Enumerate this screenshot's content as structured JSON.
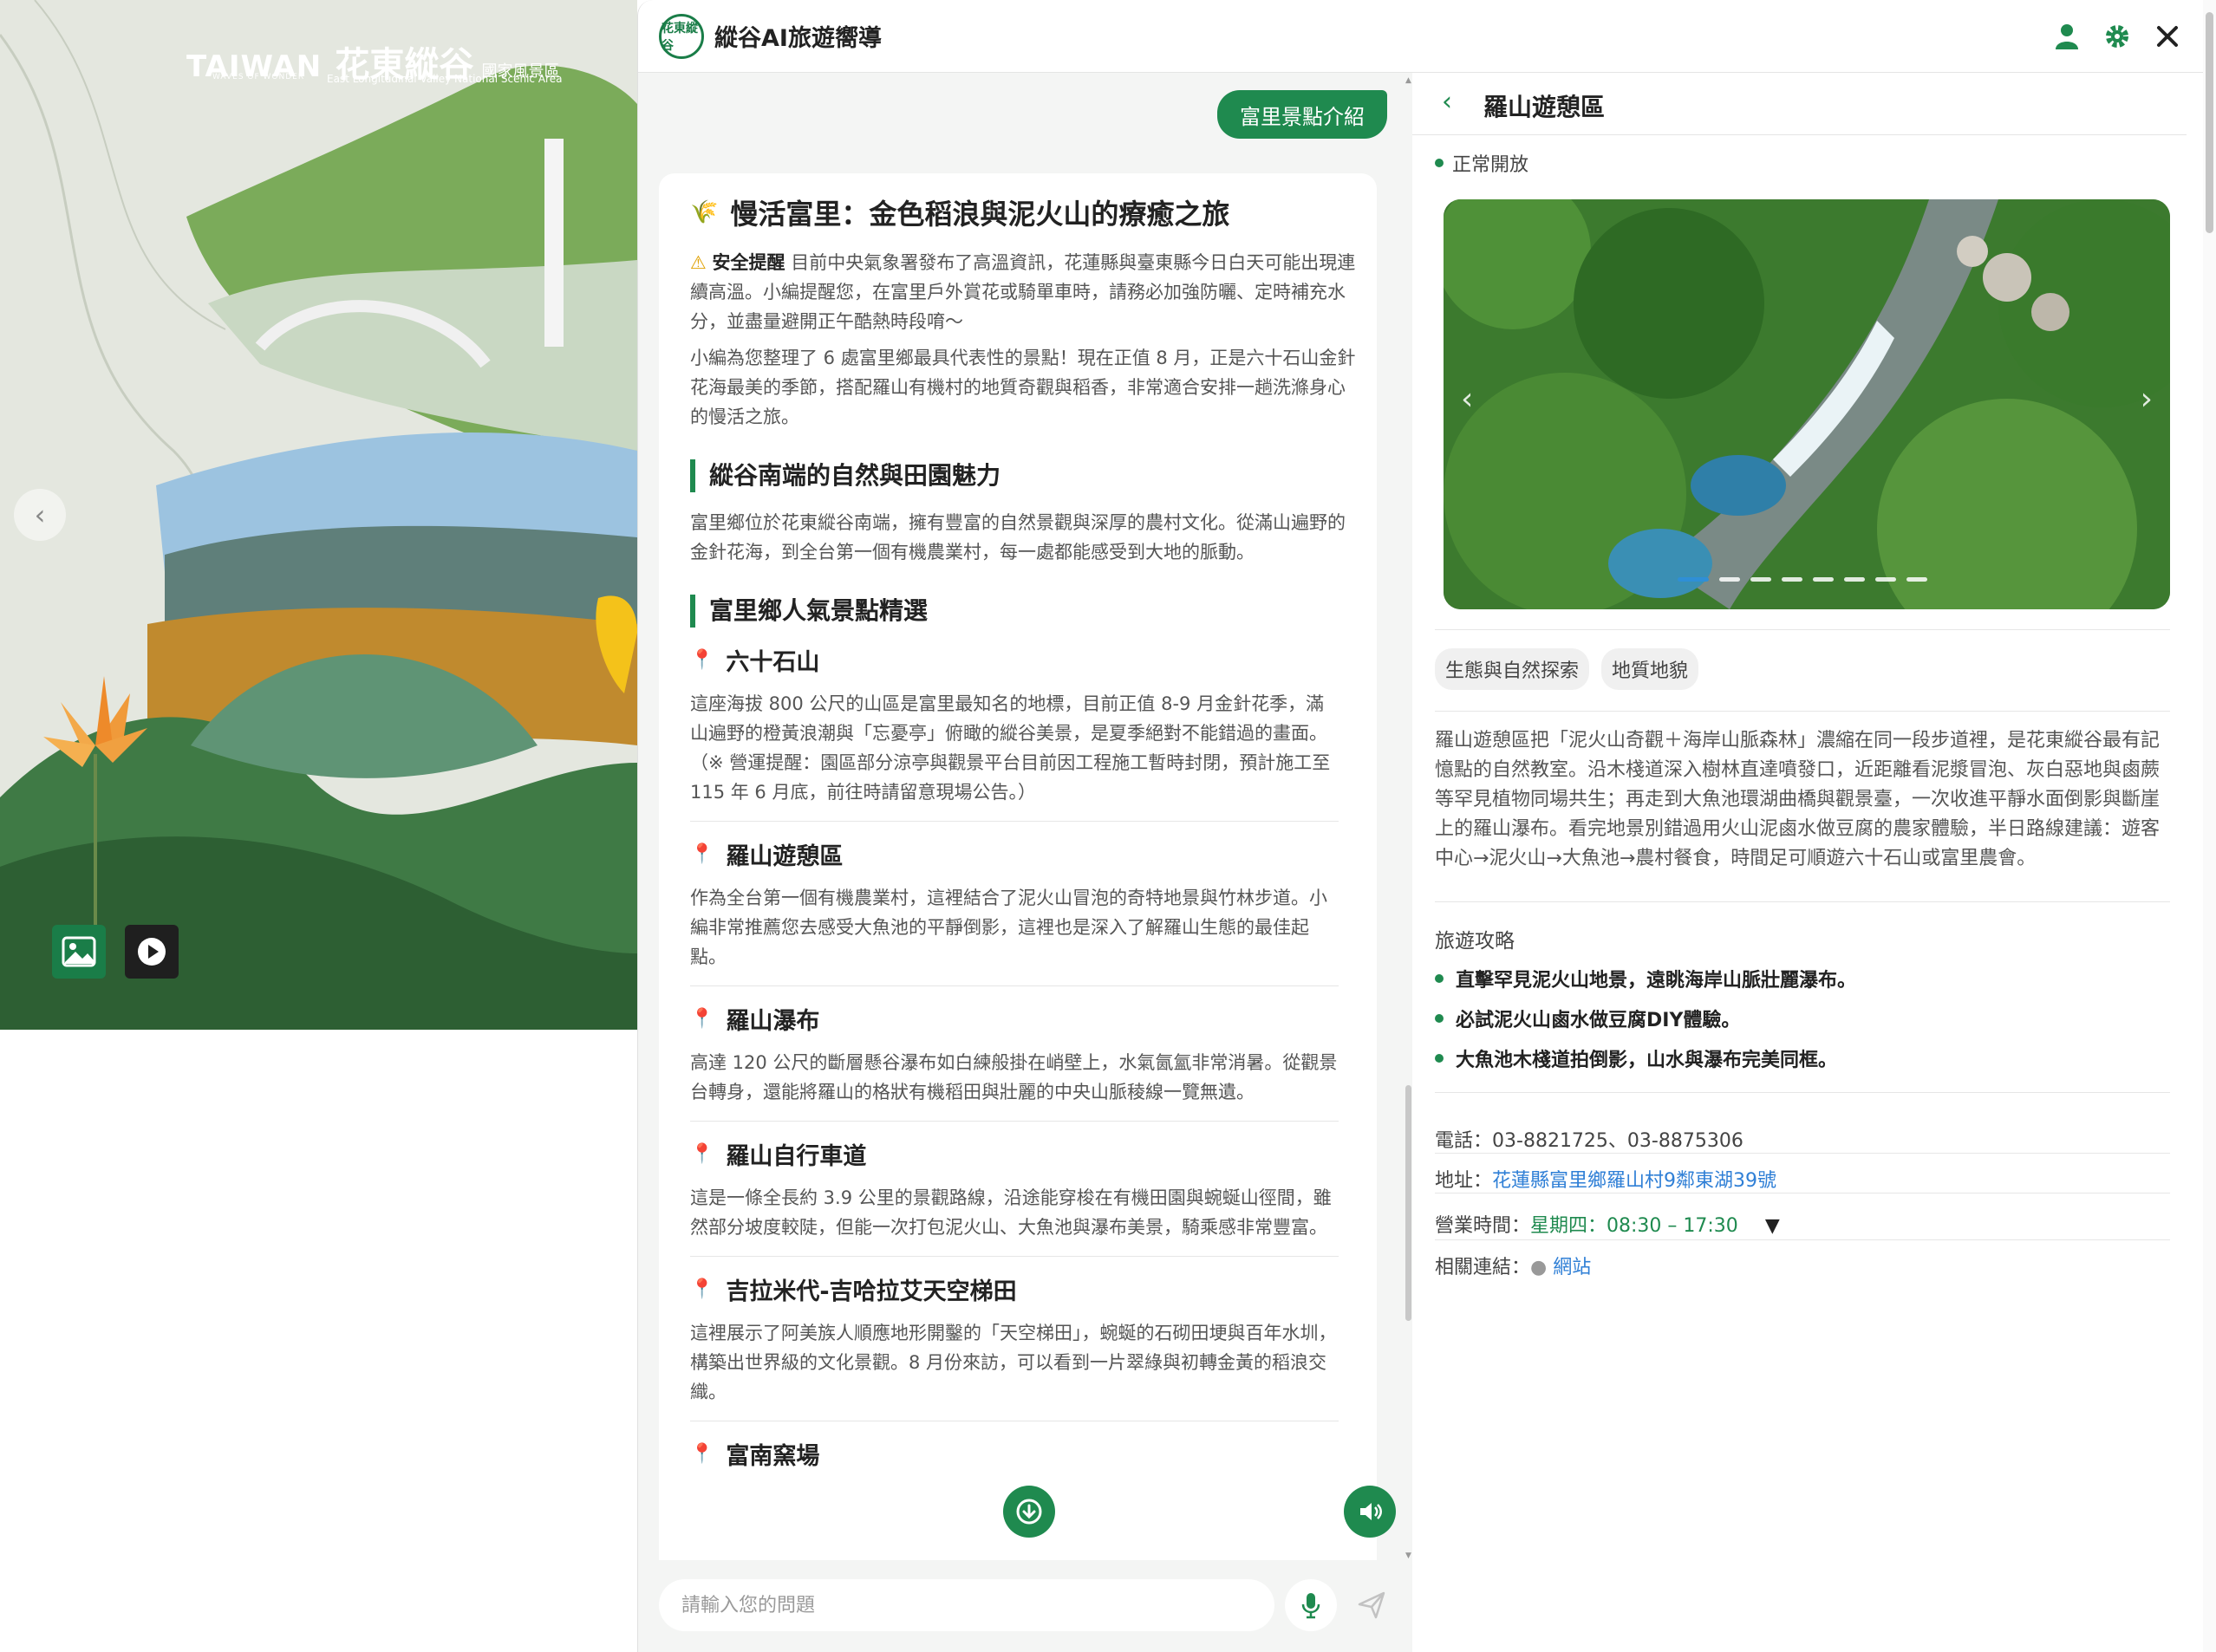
{
  "hero": {
    "brand": "TAIWAN",
    "brand_cn": "花東縱谷",
    "brand_small": "國家風景區",
    "tagline": "WAVES OF WONDER",
    "subtitle": "East Longitudinal Valley National Scenic Area"
  },
  "app": {
    "logo_text": "花東縱谷",
    "title": "縱谷AI旅遊嚮導"
  },
  "chat": {
    "user_message": "富里景點介紹",
    "reply": {
      "title": "慢活富里：金色稻浪與泥火山的療癒之旅",
      "warning_label": "安全提醒",
      "warning_text": "目前中央氣象署發布了高溫資訊，花蓮縣與臺東縣今日白天可能出現連續高溫。小編提醒您，在富里戶外賞花或騎單車時，請務必加強防曬、定時補充水分，並盡量避開正午酷熱時段唷～",
      "intro": "小編為您整理了 6 處富里鄉最具代表性的景點！現在正值 8 月，正是六十石山金針花海最美的季節，搭配羅山有機村的地質奇觀與稻香，非常適合安排一趟洗滌身心的慢活之旅。",
      "section1_title": "縱谷南端的自然與田園魅力",
      "section1_text": "富里鄉位於花東縱谷南端，擁有豐富的自然景觀與深厚的農村文化。從滿山遍野的金針花海，到全台第一個有機農業村，每一處都能感受到大地的脈動。",
      "section2_title": "富里鄉人氣景點精選",
      "spots": [
        {
          "name": "六十石山",
          "text": "這座海拔 800 公尺的山區是富里最知名的地標，目前正值 8-9 月金針花季，滿山遍野的橙黃浪潮與「忘憂亭」俯瞰的縱谷美景，是夏季絕對不能錯過的畫面。（※ 營運提醒：園區部分涼亭與觀景平台目前因工程施工暫時封閉，預計施工至 115 年 6 月底，前往時請留意現場公告。）"
        },
        {
          "name": "羅山遊憩區",
          "text": "作為全台第一個有機農業村，這裡結合了泥火山冒泡的奇特地景與竹林步道。小編非常推薦您去感受大魚池的平靜倒影，這裡也是深入了解羅山生態的最佳起點。"
        },
        {
          "name": "羅山瀑布",
          "text": "高達 120 公尺的斷層懸谷瀑布如白練般掛在峭壁上，水氣氤氳非常消暑。從觀景台轉身，還能將羅山的格狀有機稻田與壯麗的中央山脈稜線一覽無遺。"
        },
        {
          "name": "羅山自行車道",
          "text": "這是一條全長約 3.9 公里的景觀路線，沿途能穿梭在有機田園與蜿蜒山徑間，雖然部分坡度較陡，但能一次打包泥火山、大魚池與瀑布美景，騎乘感非常豐富。"
        },
        {
          "name": "吉拉米代-吉哈拉艾天空梯田",
          "text": "這裡展示了阿美族人順應地形開鑿的「天空梯田」，蜿蜒的石砌田埂與百年水圳，構築出世界級的文化景觀。8 月份來訪，可以看到一片翠綠與初轉金黃的稻浪交織。"
        },
        {
          "name": "富南窯場",
          "text": ""
        }
      ]
    },
    "input_placeholder": "請輸入您的問題"
  },
  "detail": {
    "name": "羅山遊憩區",
    "status": "正常開放",
    "tags": [
      "生態與自然探索",
      "地質地貌"
    ],
    "description": "羅山遊憩區把「泥火山奇觀＋海岸山脈森林」濃縮在同一段步道裡，是花東縱谷最有記憶點的自然教室。沿木棧道深入樹林直達噴發口，近距離看泥漿冒泡、灰白惡地與鹵蕨等罕見植物同場共生；再走到大魚池環湖曲橋與觀景臺，一次收進平靜水面倒影與斷崖上的羅山瀑布。看完地景別錯過用火山泥鹵水做豆腐的農家體驗，半日路線建議：遊客中心→泥火山→大魚池→農村餐食，時間足可順遊六十石山或富里農會。",
    "tips_title": "旅遊攻略",
    "tips": [
      "直擊罕見泥火山地景，遠眺海岸山脈壯麗瀑布。",
      "必試泥火山鹵水做豆腐DIY體驗。",
      "大魚池木棧道拍倒影，山水與瀑布完美同框。"
    ],
    "phone_label": "電話：",
    "phone": "03-8821725、03-8875306",
    "address_label": "地址：",
    "address": "花蓮縣富里鄉羅山村9鄰東湖39號",
    "hours_label": "營業時間：",
    "hours": "星期四：08:30 – 17:30",
    "links_label": "相關連結：",
    "link_text": "網站",
    "carousel_total": 8,
    "carousel_active": 1
  },
  "colors": {
    "accent": "#1f8a4f",
    "link": "#2f7fd6"
  }
}
